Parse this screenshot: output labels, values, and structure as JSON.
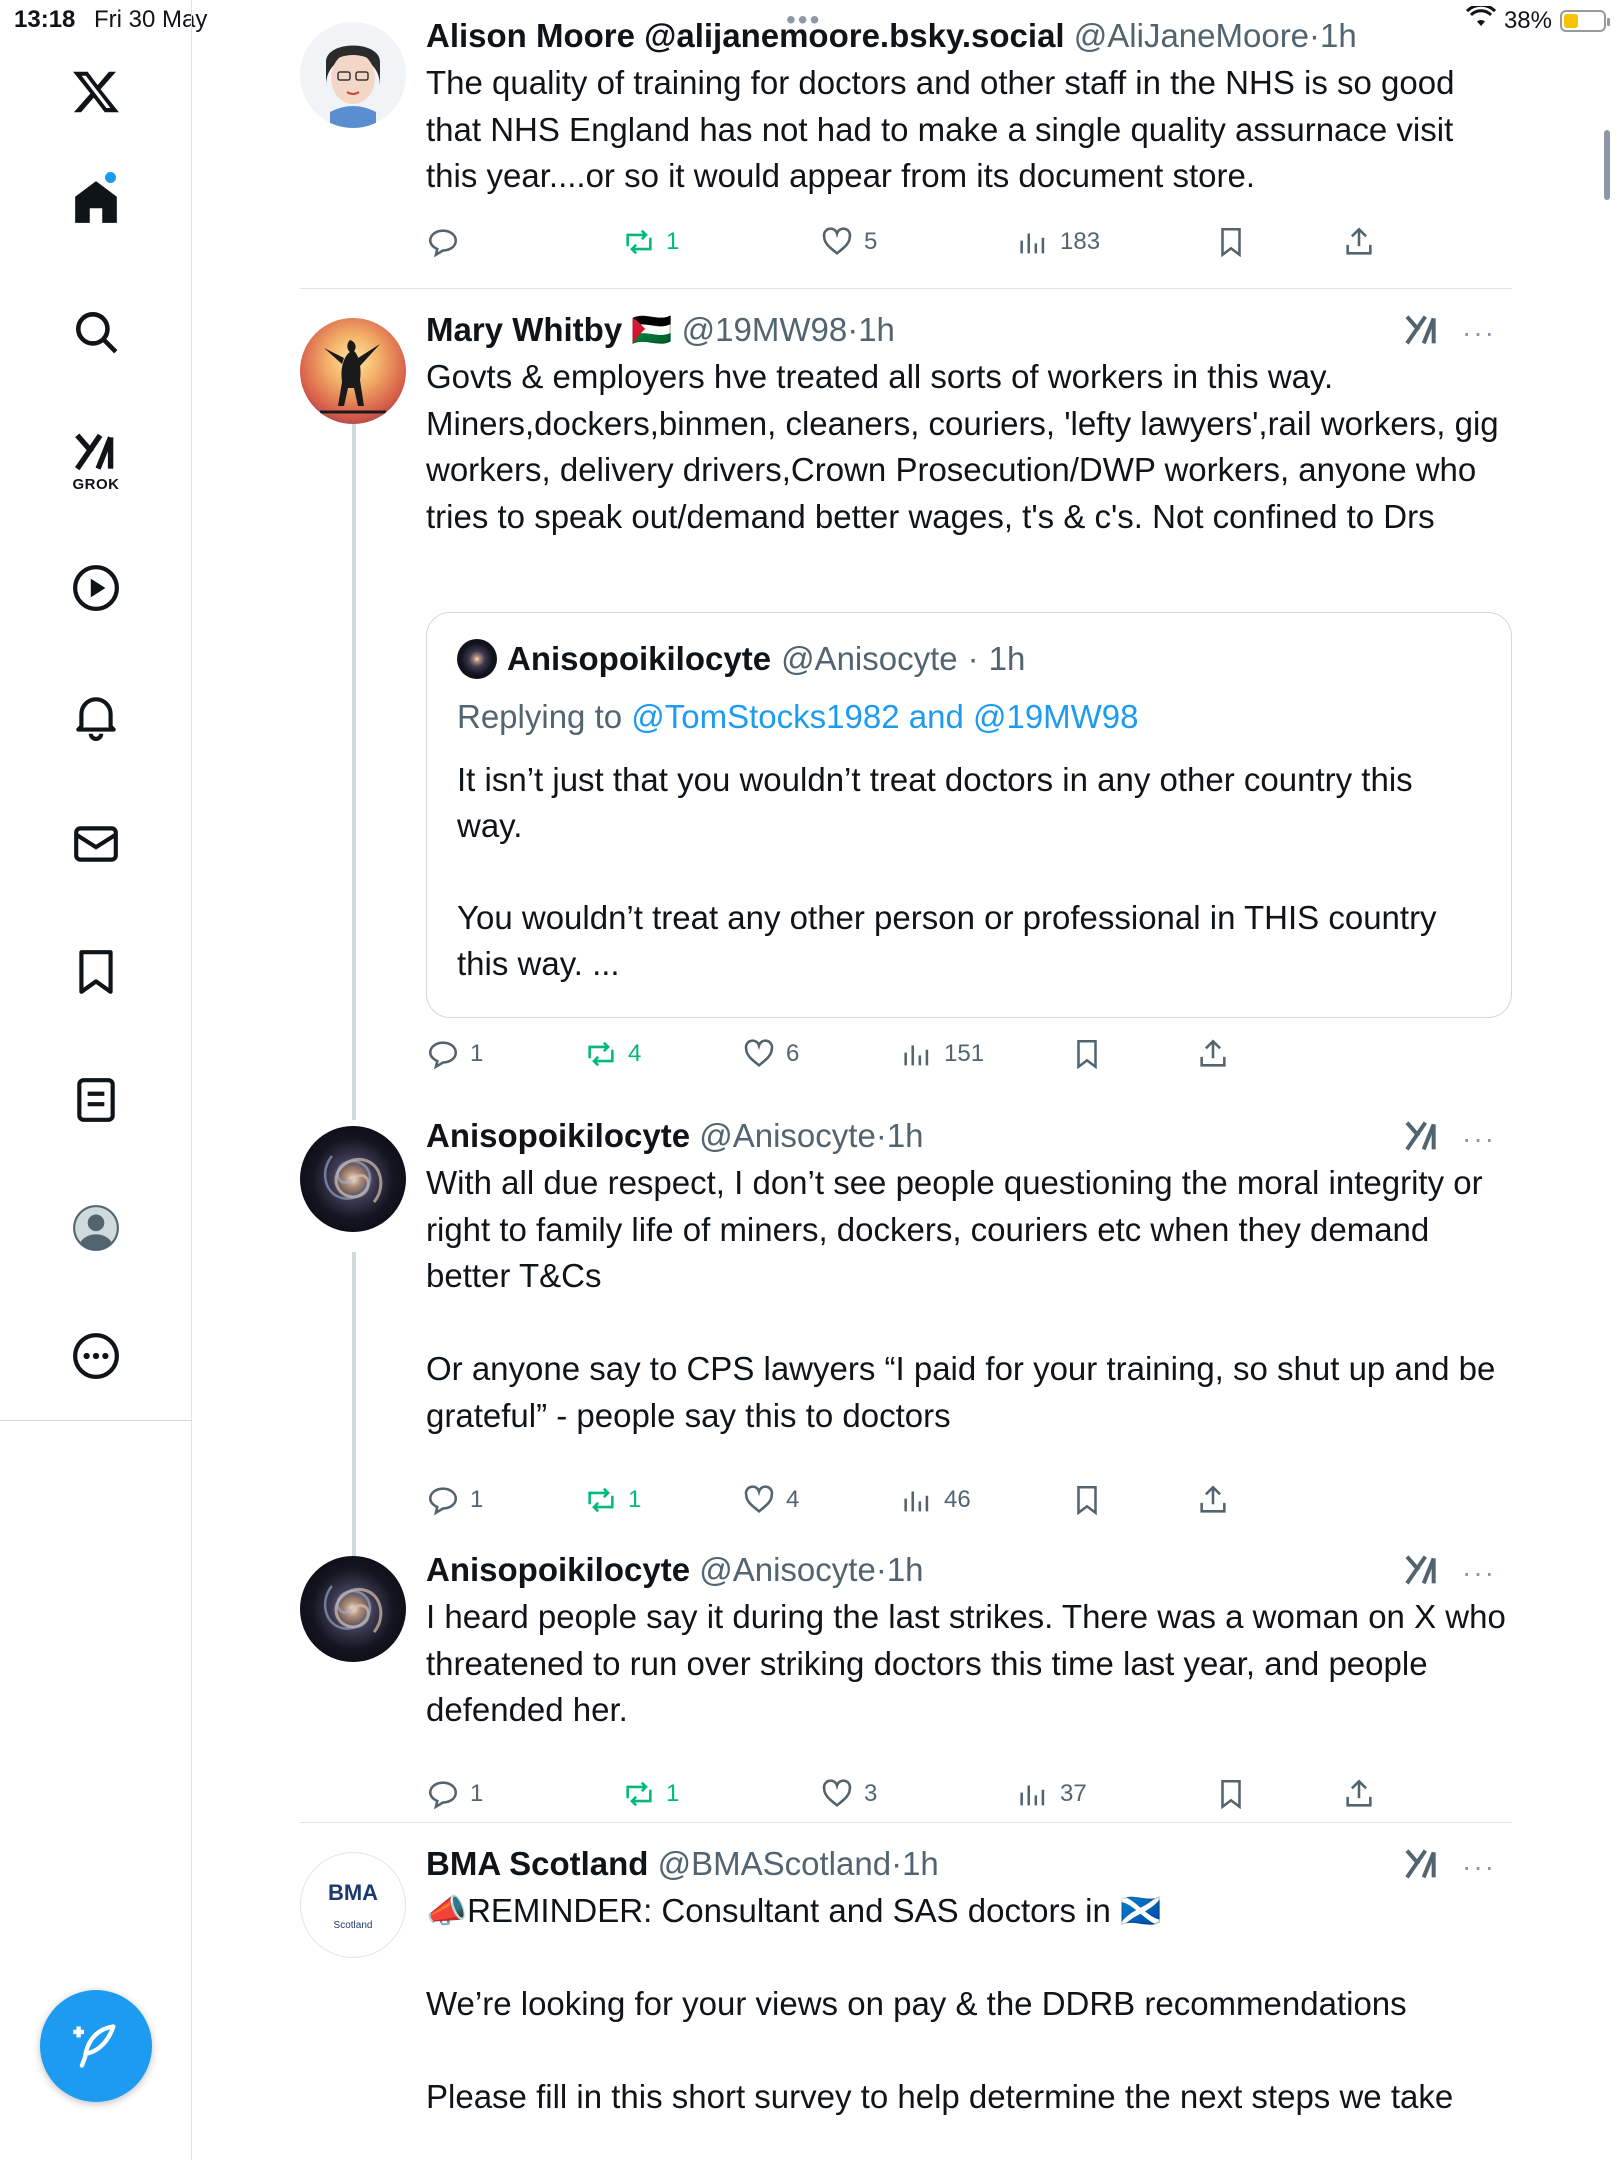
{
  "status_bar": {
    "time": "13:18",
    "date": "Fri 30 May",
    "battery": "38%",
    "battery_level": 0.38
  },
  "sidebar": {
    "items": [
      {
        "name": "logo",
        "icon": "x-logo-icon"
      },
      {
        "name": "home",
        "icon": "home-icon",
        "has_notification_dot": true
      },
      {
        "name": "search",
        "icon": "search-icon"
      },
      {
        "name": "grok",
        "icon": "grok-icon",
        "label": "GROK"
      },
      {
        "name": "video",
        "icon": "play-icon"
      },
      {
        "name": "notifications",
        "icon": "bell-icon"
      },
      {
        "name": "messages",
        "icon": "mail-icon"
      },
      {
        "name": "bookmarks",
        "icon": "bookmark-icon"
      },
      {
        "name": "lists",
        "icon": "list-icon"
      },
      {
        "name": "profile",
        "icon": "profile-icon"
      },
      {
        "name": "more",
        "icon": "more-icon"
      }
    ],
    "compose_icon": "compose-icon"
  },
  "posts": [
    {
      "name": "Alison Moore @alijanemoore.bsky.social",
      "handle": "@AliJaneMoore",
      "time": "1h",
      "text": [
        "The quality of training for doctors and other staff in the NHS is so good that NHS England has not had to make a single quality assurnace visit this year....or so it would appear from its document store."
      ],
      "replies": "",
      "reposts": "1",
      "likes": "5",
      "views": "183"
    },
    {
      "name": "Mary Whitby",
      "flag": "🇵🇸",
      "handle": "@19MW98",
      "time": "1h",
      "text": [
        "Govts & employers hve treated all sorts of workers in this way. Miners,dockers,binmen, cleaners, couriers, 'lefty lawyers',rail workers, gig workers, delivery drivers,Crown Prosecution/DWP workers, anyone who tries to speak out/demand better wages, t's & c's. Not confined to Drs"
      ],
      "quote": {
        "name": "Anisopoikilocyte",
        "handle": "@Anisocyte",
        "time": "1h",
        "replying_prefix": "Replying to",
        "replying_to": "@TomStocks1982 and @19MW98",
        "text": [
          "It isn’t just that you wouldn’t treat doctors in any other country this way.",
          "",
          "You wouldn’t treat any other person or professional in THIS country this way. ..."
        ]
      },
      "replies": "1",
      "reposts": "4",
      "likes": "6",
      "views": "151"
    },
    {
      "name": "Anisopoikilocyte",
      "handle": "@Anisocyte",
      "time": "1h",
      "text": [
        "With all due respect, I don’t see people questioning the moral integrity or right to family life of miners, dockers, couriers etc when they demand better T&Cs",
        "",
        "Or anyone say to CPS lawyers “I paid for your training, so shut up and be grateful” - people say this to doctors"
      ],
      "replies": "1",
      "reposts": "1",
      "likes": "4",
      "views": "46"
    },
    {
      "name": "Anisopoikilocyte",
      "handle": "@Anisocyte",
      "time": "1h",
      "text": [
        "I heard people say it during the last strikes. There was a woman on X who threatened to run over striking doctors this time last year, and people defended her."
      ],
      "replies": "1",
      "reposts": "1",
      "likes": "3",
      "views": "37"
    },
    {
      "name": "BMA Scotland",
      "handle": "@BMAScotland",
      "time": "1h",
      "avatar_text": "BMA",
      "avatar_subtext": "Scotland",
      "text": [
        "📣REMINDER: Consultant and SAS doctors in 🏴󠁧󠁢󠁳󠁣󠁴󠁿",
        "",
        "We’re looking for your views on pay & the DDRB recommendations",
        "",
        "Please fill in this short survey to help determine the next steps we take"
      ]
    }
  ]
}
